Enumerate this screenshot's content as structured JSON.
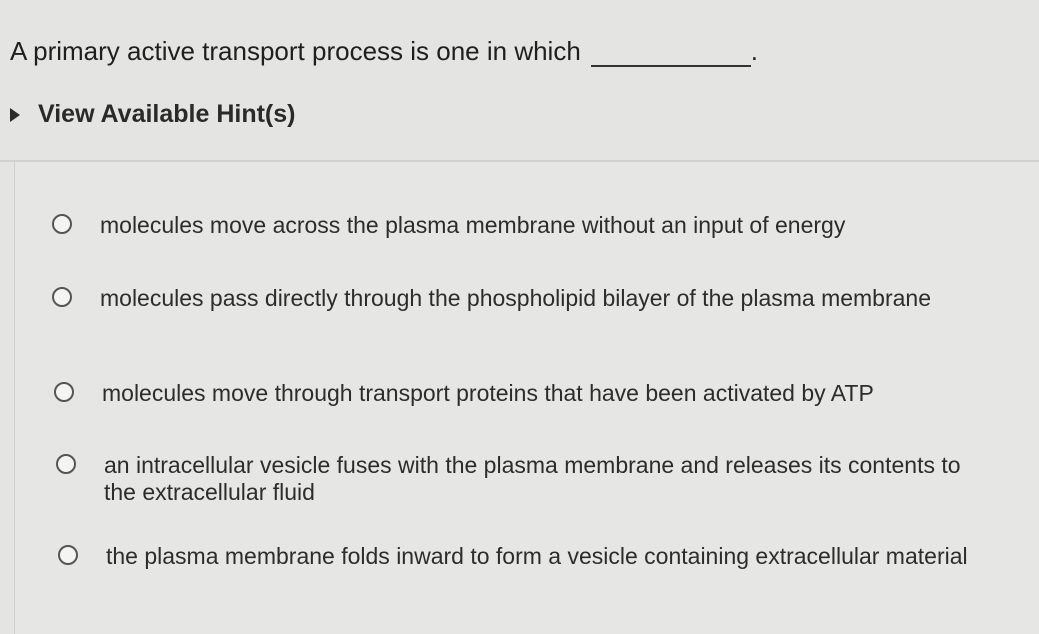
{
  "question": {
    "text": "A primary active transport process is one in which",
    "trailing": "."
  },
  "hint": {
    "label": "View Available Hint(s)",
    "icon": "caret-right-icon"
  },
  "choices": [
    {
      "label": "molecules move across the plasma membrane without an input of energy"
    },
    {
      "label": "molecules pass directly through the phospholipid bilayer of the plasma membrane"
    },
    {
      "label": "molecules move through transport proteins that have been activated by ATP"
    },
    {
      "label": "an intracellular vesicle fuses with the plasma membrane and releases its contents to the extracellular fluid"
    },
    {
      "label": "the plasma membrane folds inward to form a vesicle containing extracellular material"
    }
  ],
  "colors": {
    "background": "#e4e5e2",
    "text": "#2b2b2b"
  }
}
